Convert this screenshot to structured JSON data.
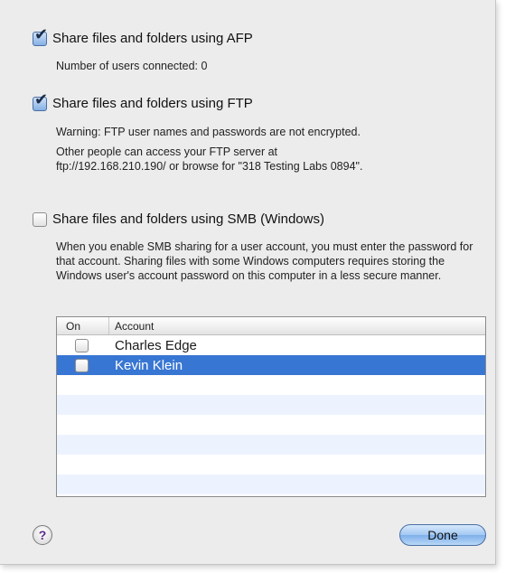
{
  "afp": {
    "label": "Share files and folders using AFP",
    "checked": true,
    "users_connected": "Number of users connected: 0"
  },
  "ftp": {
    "label": "Share files and folders using FTP",
    "checked": true,
    "warning": "Warning: FTP user names and passwords are not encrypted.",
    "access_line1": "Other people can access your FTP server at",
    "access_line2": "ftp://192.168.210.190/ or browse for \"318 Testing Labs 0894\"."
  },
  "smb": {
    "label": "Share files and folders using SMB (Windows)",
    "checked": false,
    "description": "When you enable SMB sharing for a user account, you must enter the password for that account. Sharing files with some Windows computers requires storing the Windows user's account password on this computer in a less secure manner."
  },
  "accounts_table": {
    "columns": [
      "On",
      "Account"
    ],
    "rows": [
      {
        "on": false,
        "account": "Charles Edge",
        "selected": false
      },
      {
        "on": false,
        "account": "Kevin Klein",
        "selected": true
      }
    ]
  },
  "footer": {
    "help_label": "?",
    "done_label": "Done"
  },
  "colors": {
    "selection": "#3876d3",
    "alt_row": "#edf3fe",
    "sheet_bg": "#ececec"
  },
  "icons": {
    "checkmark": "checkmark-icon",
    "help": "question-mark-icon"
  }
}
